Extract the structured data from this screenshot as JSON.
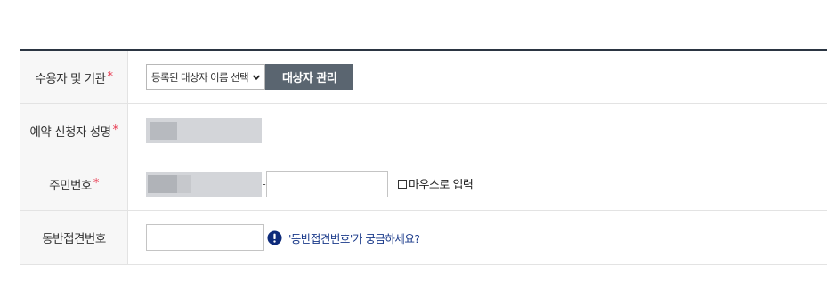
{
  "rows": {
    "recipient": {
      "label": "수용자 및 기관",
      "required_mark": "*",
      "select_value": "등록된 대상자 이름 선택",
      "manage_button": "대상자 관리"
    },
    "applicant": {
      "label": "예약 신청자 성명",
      "required_mark": "*"
    },
    "resident_id": {
      "label": "주민번호",
      "required_mark": "*",
      "separator": "-",
      "mouse_input_label": "마우스로 입력"
    },
    "companion": {
      "label": "동반접견번호",
      "help_link": "'동반접견번호'가 궁금하세요?"
    }
  },
  "colors": {
    "header_border": "#2b3542",
    "required": "#e8384f",
    "button_bg": "#5a6570",
    "link": "#1a3a8a",
    "info_icon": "#0d2a7a"
  }
}
